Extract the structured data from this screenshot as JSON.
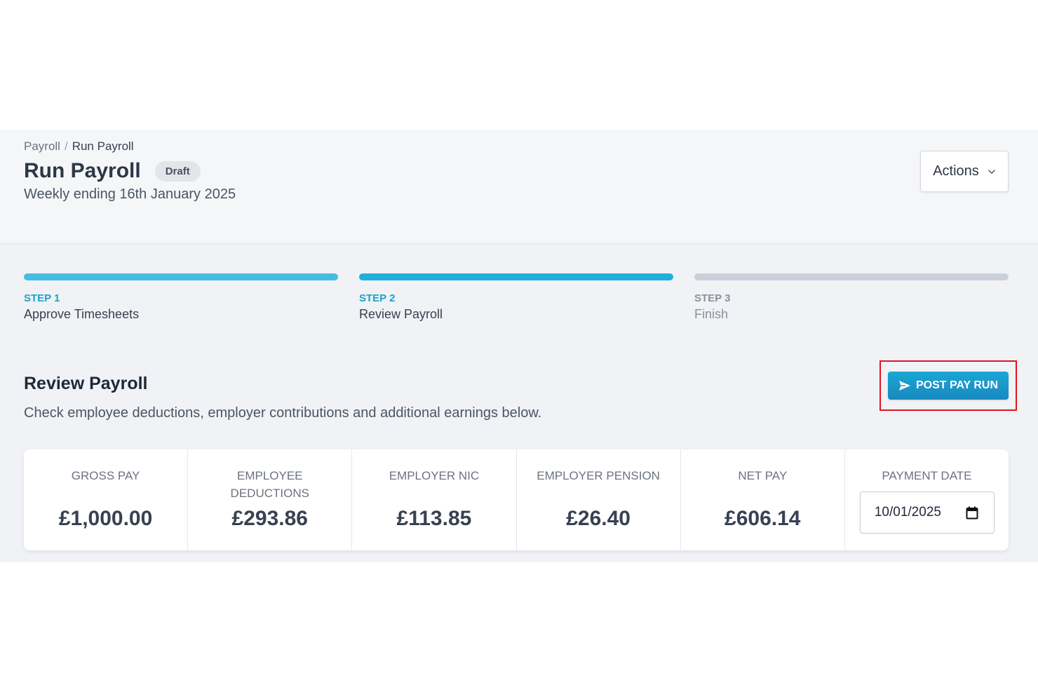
{
  "breadcrumb": {
    "parent": "Payroll",
    "separator": "/",
    "current": "Run Payroll"
  },
  "header": {
    "title": "Run Payroll",
    "status_badge": "Draft",
    "subtitle": "Weekly ending 16th January 2025",
    "actions_label": "Actions",
    "actions_icon": "chevron-down-icon"
  },
  "steps": [
    {
      "number": "STEP 1",
      "label": "Approve Timesheets",
      "state": "complete"
    },
    {
      "number": "STEP 2",
      "label": "Review Payroll",
      "state": "active"
    },
    {
      "number": "STEP 3",
      "label": "Finish",
      "state": "pending"
    }
  ],
  "section": {
    "title": "Review Payroll",
    "description": "Check employee deductions, employer contributions and additional earnings below.",
    "post_button_label": "POST PAY RUN",
    "post_button_icon": "send-icon"
  },
  "summary": {
    "gross_pay": {
      "label": "GROSS PAY",
      "value": "£1,000.00"
    },
    "employee_deductions": {
      "label": "EMPLOYEE DEDUCTIONS",
      "value": "£293.86"
    },
    "employer_nic": {
      "label": "EMPLOYER NIC",
      "value": "£113.85"
    },
    "employer_pension": {
      "label": "EMPLOYER PENSION",
      "value": "£26.40"
    },
    "net_pay": {
      "label": "NET PAY",
      "value": "£606.14"
    },
    "payment_date": {
      "label": "PAYMENT DATE",
      "value": "10/01/2025",
      "icon": "calendar-icon"
    }
  },
  "colors": {
    "accent": "#1fb0d9",
    "button": "#1989bf",
    "highlight_border": "#e0141d",
    "pending_bar": "#cbd1da"
  }
}
